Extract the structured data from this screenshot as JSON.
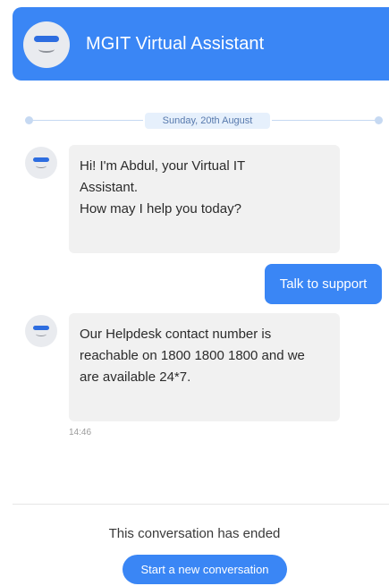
{
  "header": {
    "title": "MGIT Virtual Assistant",
    "avatar_icon": "bot-icon"
  },
  "conversation": {
    "date_divider": "Sunday, 20th August",
    "messages": [
      {
        "sender": "bot",
        "lines": [
          "Hi! I'm Abdul, your Virtual IT",
          "Assistant.",
          "How may I help you today?"
        ]
      },
      {
        "sender": "user",
        "text": "Talk to support"
      },
      {
        "sender": "bot",
        "lines": [
          "Our Helpdesk contact number is",
          "reachable on 1800 1800 1800 and we",
          "are available 24*7."
        ],
        "timestamp": "14:46"
      }
    ]
  },
  "footer": {
    "ended_text": "This conversation has ended",
    "new_conversation_label": "Start a new conversation"
  },
  "colors": {
    "accent": "#3a86f5",
    "bot_bubble": "#f1f1f1",
    "date_pill": "#e6f0fc"
  }
}
